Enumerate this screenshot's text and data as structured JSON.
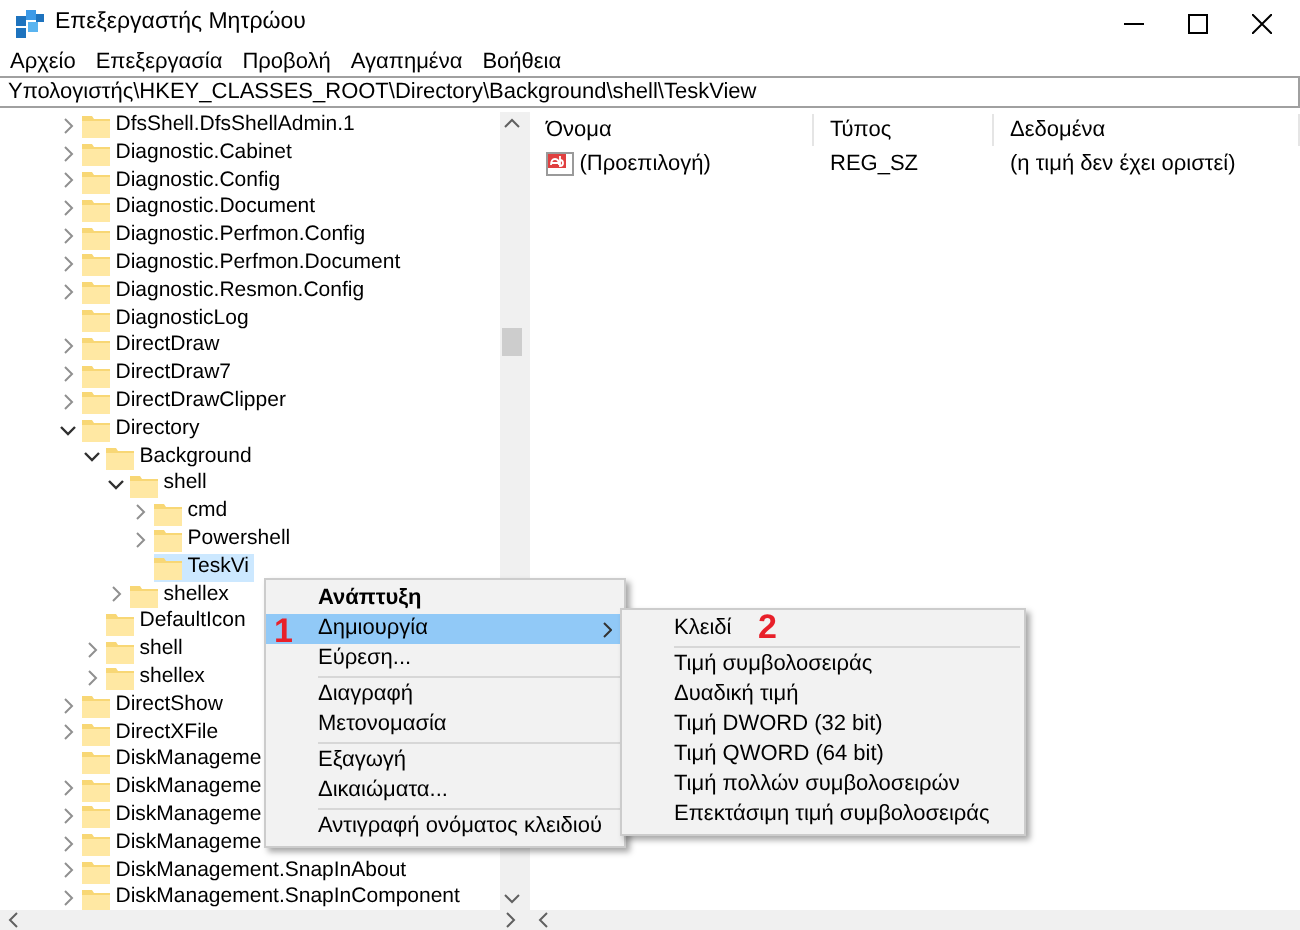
{
  "window": {
    "title": "Επεξεργαστής Μητρώου"
  },
  "menu_bar": [
    "Αρχείο",
    "Επεξεργασία",
    "Προβολή",
    "Αγαπημένα",
    "Βοήθεια"
  ],
  "address": "Υπολογιστής\\HKEY_CLASSES_ROOT\\Directory\\Background\\shell\\TeskView",
  "tree": [
    {
      "label": "DfsShell.DfsShellAdmin.1",
      "leaf": false,
      "expanded": false,
      "selected": false
    },
    {
      "label": "Diagnostic.Cabinet",
      "leaf": false,
      "expanded": false,
      "selected": false
    },
    {
      "label": "Diagnostic.Config",
      "leaf": false,
      "expanded": false,
      "selected": false
    },
    {
      "label": "Diagnostic.Document",
      "leaf": false,
      "expanded": false,
      "selected": false
    },
    {
      "label": "Diagnostic.Perfmon.Config",
      "leaf": false,
      "expanded": false,
      "selected": false
    },
    {
      "label": "Diagnostic.Perfmon.Document",
      "leaf": false,
      "expanded": false,
      "selected": false
    },
    {
      "label": "Diagnostic.Resmon.Config",
      "leaf": false,
      "expanded": false,
      "selected": false
    },
    {
      "label": "DiagnosticLog",
      "leaf": true,
      "selected": false
    },
    {
      "label": "DirectDraw",
      "leaf": false,
      "expanded": false,
      "selected": false
    },
    {
      "label": "DirectDraw7",
      "leaf": false,
      "expanded": false,
      "selected": false
    },
    {
      "label": "DirectDrawClipper",
      "leaf": false,
      "expanded": false,
      "selected": false
    },
    {
      "label": "Directory",
      "leaf": false,
      "expanded": true,
      "selected": false,
      "children": [
        {
          "label": "Background",
          "leaf": false,
          "expanded": true,
          "selected": false,
          "children": [
            {
              "label": "shell",
              "leaf": false,
              "expanded": true,
              "selected": false,
              "children": [
                {
                  "label": "cmd",
                  "leaf": false,
                  "expanded": false,
                  "selected": false
                },
                {
                  "label": "Powershell",
                  "leaf": false,
                  "expanded": false,
                  "selected": false
                },
                {
                  "label": "TeskVi",
                  "leaf": true,
                  "selected": true
                }
              ]
            },
            {
              "label": "shellex",
              "leaf": false,
              "expanded": false,
              "selected": false
            }
          ]
        },
        {
          "label": "DefaultIcon",
          "leaf": true,
          "selected": false
        },
        {
          "label": "shell",
          "leaf": false,
          "expanded": false,
          "selected": false
        },
        {
          "label": "shellex",
          "leaf": false,
          "expanded": false,
          "selected": false
        }
      ]
    },
    {
      "label": "DirectShow",
      "leaf": false,
      "expanded": false,
      "selected": false
    },
    {
      "label": "DirectXFile",
      "leaf": false,
      "expanded": false,
      "selected": false
    },
    {
      "label": "DiskManageme",
      "leaf": true,
      "selected": false
    },
    {
      "label": "DiskManageme",
      "leaf": false,
      "expanded": false,
      "selected": false
    },
    {
      "label": "DiskManageme",
      "leaf": false,
      "expanded": false,
      "selected": false
    },
    {
      "label": "DiskManageme",
      "leaf": false,
      "expanded": false,
      "selected": false
    },
    {
      "label": "DiskManagement.SnapInAbout",
      "leaf": false,
      "expanded": false,
      "selected": false
    },
    {
      "label": "DiskManagement.SnapInComponent",
      "leaf": false,
      "expanded": false,
      "selected": false
    }
  ],
  "values_table": {
    "columns": [
      "Όνομα",
      "Τύπος",
      "Δεδομένα"
    ],
    "rows": [
      {
        "name": "(Προεπιλογή)",
        "type": "REG_SZ",
        "data": "(η τιμή δεν έχει οριστεί)"
      }
    ]
  },
  "context_menu": {
    "items": [
      {
        "kind": "item",
        "label": "Ανάπτυξη",
        "bold": true,
        "selected": false,
        "submenu": false
      },
      {
        "kind": "item",
        "label": "Δημιουργία",
        "bold": false,
        "selected": true,
        "submenu": true,
        "annotation": "1"
      },
      {
        "kind": "item",
        "label": "Εύρεση...",
        "bold": false,
        "selected": false,
        "submenu": false
      },
      {
        "kind": "separator"
      },
      {
        "kind": "item",
        "label": "Διαγραφή",
        "bold": false,
        "selected": false,
        "submenu": false
      },
      {
        "kind": "item",
        "label": "Μετονομασία",
        "bold": false,
        "selected": false,
        "submenu": false
      },
      {
        "kind": "separator"
      },
      {
        "kind": "item",
        "label": "Εξαγωγή",
        "bold": false,
        "selected": false,
        "submenu": false
      },
      {
        "kind": "item",
        "label": "Δικαιώματα...",
        "bold": false,
        "selected": false,
        "submenu": false
      },
      {
        "kind": "separator"
      },
      {
        "kind": "item",
        "label": "Αντιγραφή ονόματος κλειδιού",
        "bold": false,
        "selected": false,
        "submenu": false
      }
    ]
  },
  "submenu": {
    "items": [
      {
        "kind": "item",
        "label": "Κλειδί",
        "bold": false,
        "selected": false,
        "submenu": false,
        "annotation": "2"
      },
      {
        "kind": "separator"
      },
      {
        "kind": "item",
        "label": "Τιμή συμβολοσειράς",
        "bold": false,
        "selected": false,
        "submenu": false
      },
      {
        "kind": "item",
        "label": "Δυαδική τιμή",
        "bold": false,
        "selected": false,
        "submenu": false
      },
      {
        "kind": "item",
        "label": "Τιμή DWORD (32 bit)",
        "bold": false,
        "selected": false,
        "submenu": false
      },
      {
        "kind": "item",
        "label": "Τιμή QWORD (64 bit)",
        "bold": false,
        "selected": false,
        "submenu": false
      },
      {
        "kind": "item",
        "label": "Τιμή πολλών συμβολοσειρών",
        "bold": false,
        "selected": false,
        "submenu": false
      },
      {
        "kind": "item",
        "label": "Επεκτάσιμη τιμή συμβολοσειράς",
        "bold": false,
        "selected": false,
        "submenu": false
      }
    ]
  }
}
